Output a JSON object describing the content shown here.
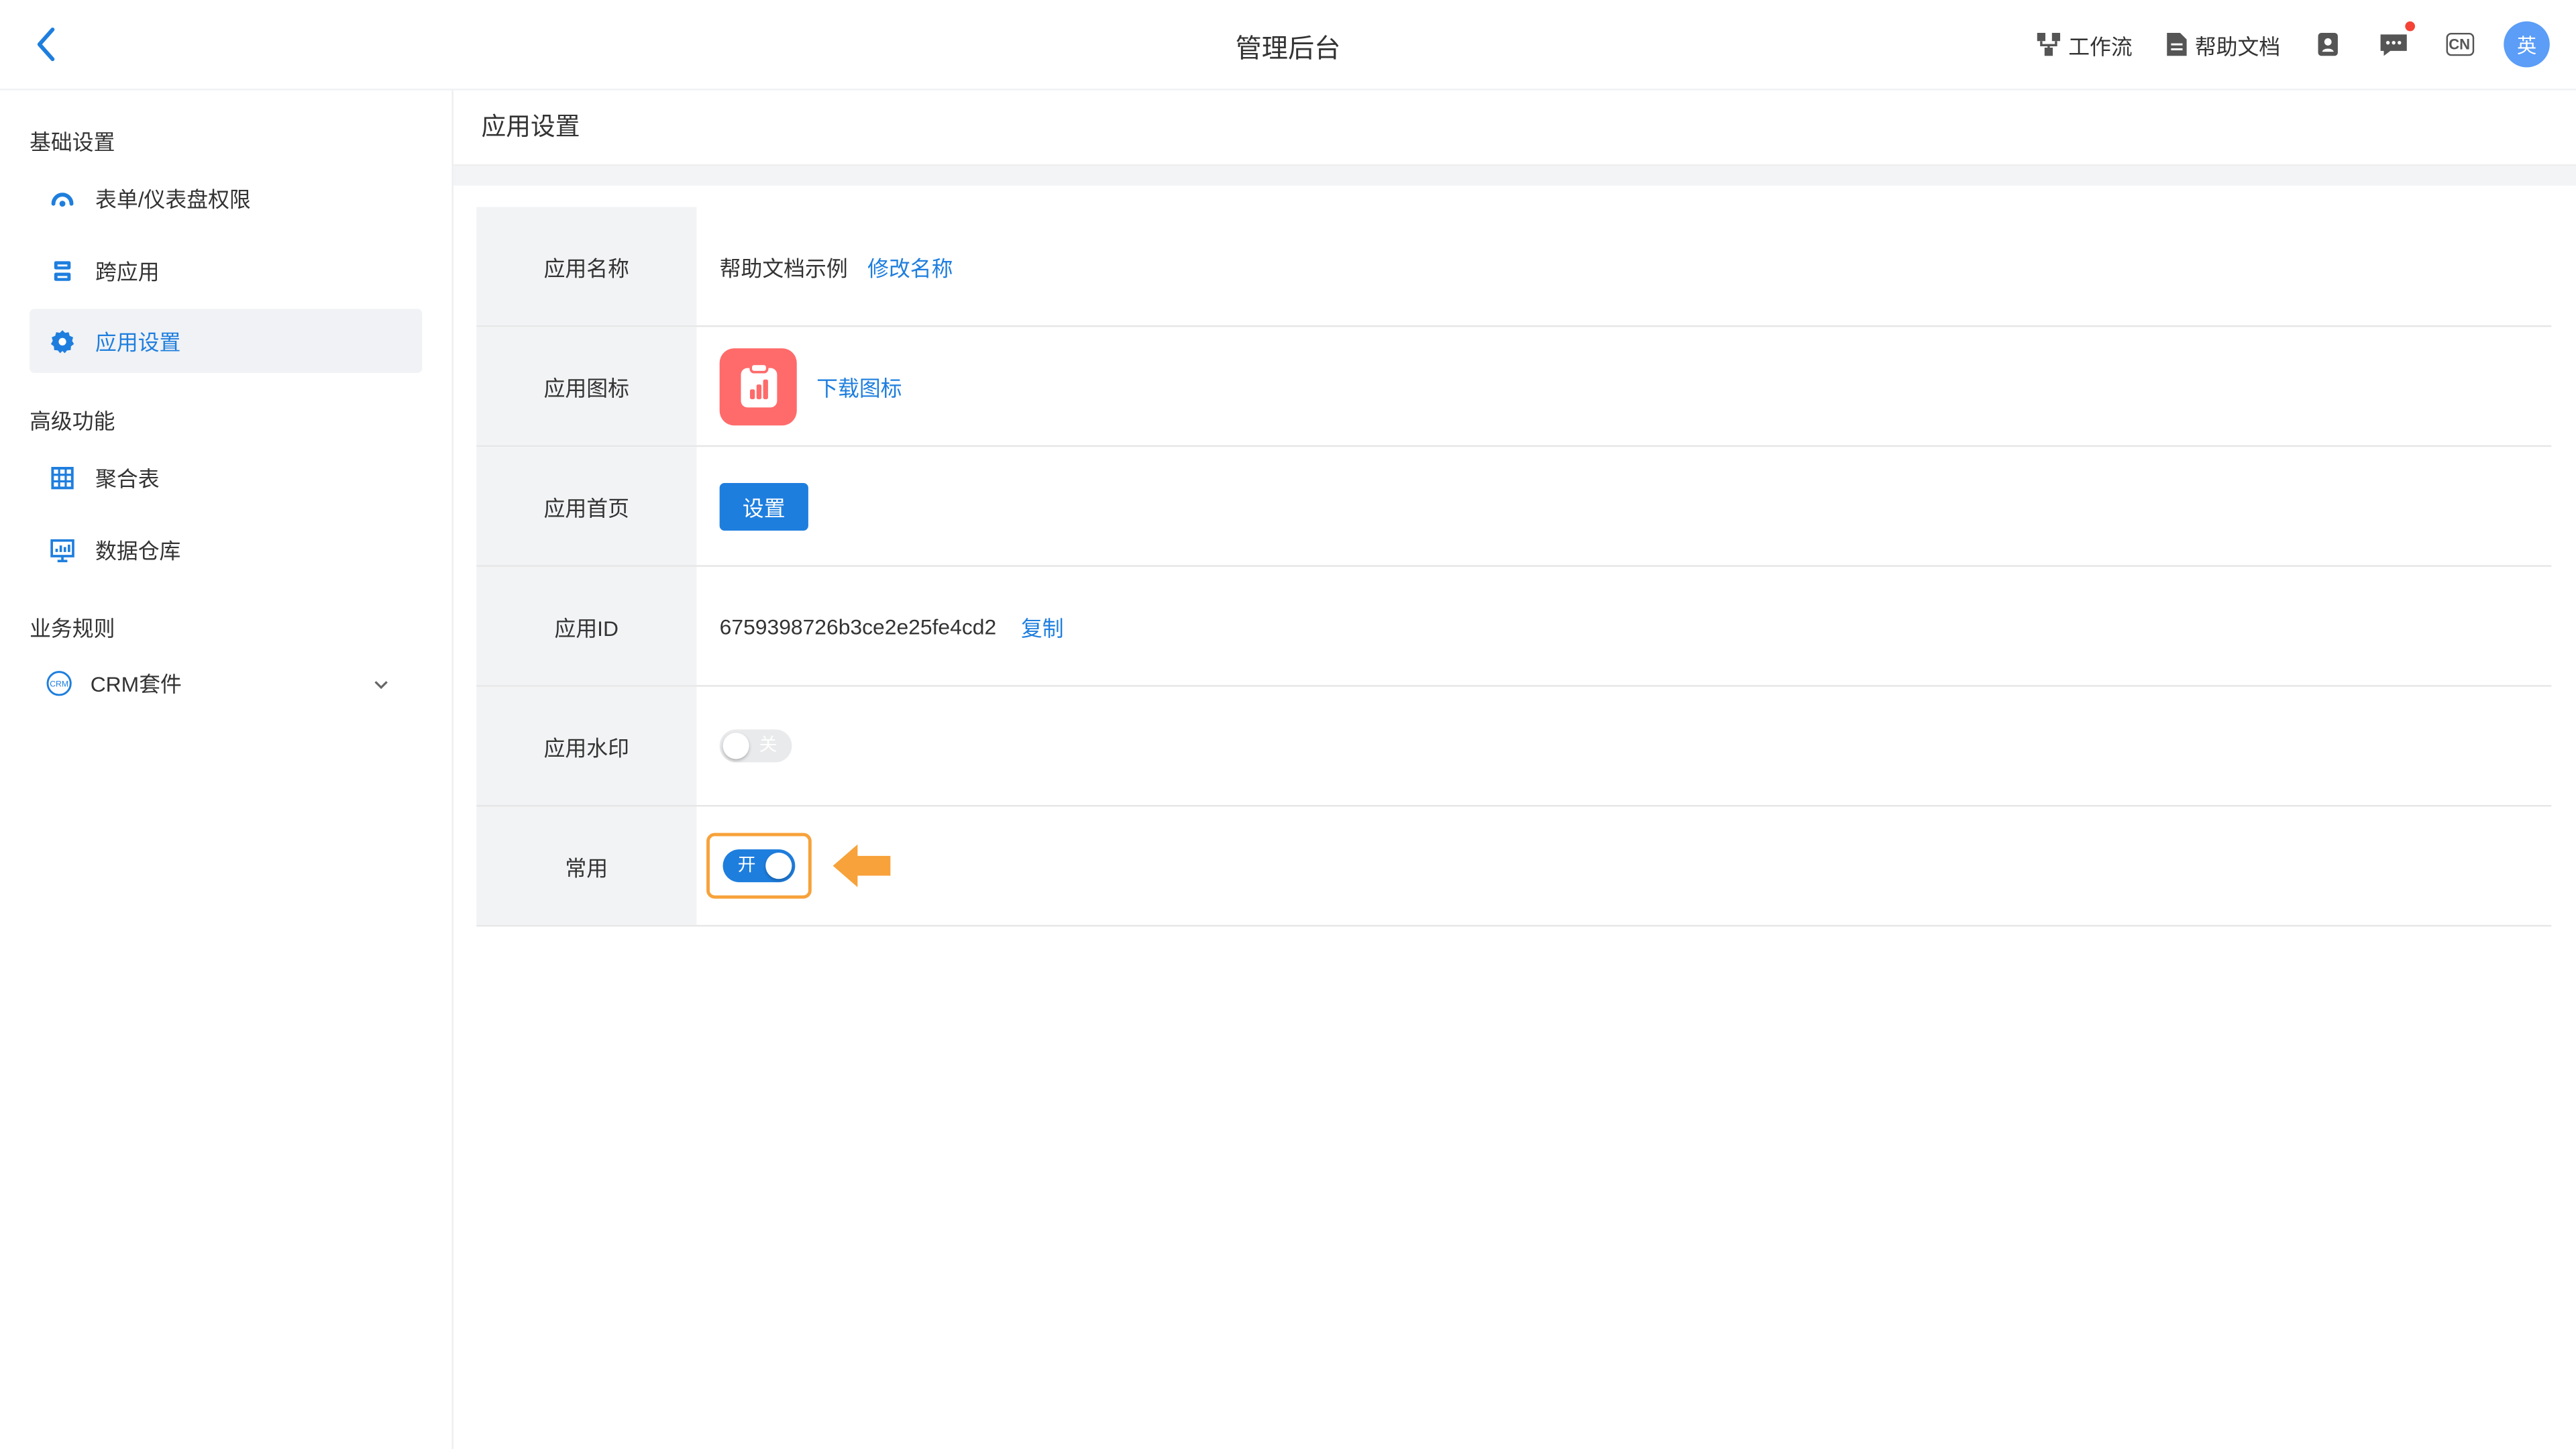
{
  "header": {
    "title": "管理后台",
    "workflow_label": "工作流",
    "help_docs_label": "帮助文档",
    "lang_badge": "CN",
    "avatar_text": "英"
  },
  "sidebar": {
    "groups": [
      {
        "title": "基础设置",
        "items": [
          {
            "label": "表单/仪表盘权限",
            "icon": "dashboard-icon"
          },
          {
            "label": "跨应用",
            "icon": "cross-app-icon"
          },
          {
            "label": "应用设置",
            "icon": "gear-icon",
            "active": true
          }
        ]
      },
      {
        "title": "高级功能",
        "items": [
          {
            "label": "聚合表",
            "icon": "table-grid-icon"
          },
          {
            "label": "数据仓库",
            "icon": "data-warehouse-icon"
          }
        ]
      },
      {
        "title": "业务规则",
        "items": [
          {
            "label": "CRM套件",
            "icon": "crm-icon",
            "expandable": true
          }
        ]
      }
    ]
  },
  "main": {
    "title": "应用设置",
    "rows": {
      "name": {
        "label": "应用名称",
        "value": "帮助文档示例",
        "action": "修改名称"
      },
      "icon": {
        "label": "应用图标",
        "action": "下载图标"
      },
      "homepage": {
        "label": "应用首页",
        "button": "设置"
      },
      "app_id": {
        "label": "应用ID",
        "value": "6759398726b3ce2e25fe4cd2",
        "action": "复制"
      },
      "watermark": {
        "label": "应用水印",
        "toggle_text": "关",
        "state": "off"
      },
      "common": {
        "label": "常用",
        "toggle_text": "开",
        "state": "on"
      }
    }
  },
  "colors": {
    "accent": "#1e7ede",
    "app_icon_bg": "#ff6b6b",
    "highlight": "#f7a23a"
  }
}
